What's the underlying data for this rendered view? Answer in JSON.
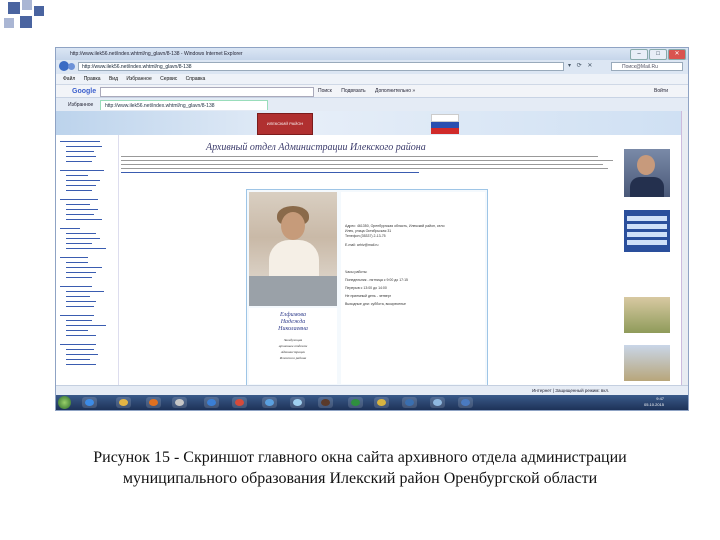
{
  "browser": {
    "window_title": "http://www.ilek56.net/index.whtml/ng_glavn/8-138 - Windows Internet Explorer",
    "address": "http://www.ilek56.net/index.whtml/ng_glavn/8-138",
    "search_placeholder": "Поиск@Mail.Ru",
    "menu": [
      "Файл",
      "Правка",
      "Вид",
      "Избранное",
      "Сервис",
      "Справка"
    ],
    "google_label": "Google",
    "google_items": [
      "Поиск",
      "Подвязать",
      "Дополнительно »"
    ],
    "login_label": "Войти",
    "favorites_label": "Избранное",
    "tab_label": "http://www.ilek56.net/index.whtml/ng_glavn/8-138"
  },
  "page": {
    "banner_emblem": "ИЛЕКСКИЙ РАЙОН",
    "heading": "Архивный отдел Администрации Илекского района",
    "name_card": {
      "name": [
        "Елфимова",
        "Надежда",
        "Николаевна"
      ],
      "sub": [
        "Заведующая",
        "архивным отделом",
        "Администрации",
        "Илекского района"
      ]
    },
    "info": {
      "address": [
        "Адрес: 461350, Оренбургская область, Илекский район, село",
        "Илек, улица Октябрьская 31",
        "Телефон (35337) 2-13-75",
        "E-mail: arhiv@mail.ru"
      ],
      "schedule_title": "Часы работы:",
      "schedule": [
        "Понедельник - пятница с 9:00 до 17:15",
        "Перерыв с 13:00 до 14:00",
        "Не приемный день - четверг",
        "Выходные дни: суббота, воскресенье"
      ]
    }
  },
  "statusbar": {
    "zone": "Интернет | Защищенный режим: вкл."
  },
  "taskbar": {
    "time": "9:47",
    "date": "05.10.2015"
  },
  "caption": "Рисунок 15 -  Скриншот главного окна сайта архивного отдела администрации муниципального образования Илекский район Оренбургской области",
  "colors": {
    "corner_squares": "#4a64a0",
    "taskbar": "#1d3258",
    "heading": "#3a3a6a"
  }
}
